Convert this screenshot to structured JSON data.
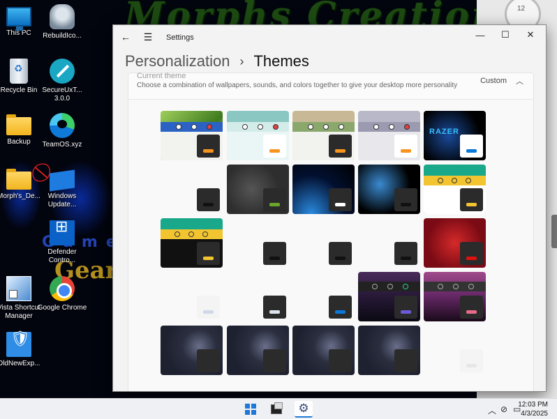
{
  "desktop": {
    "wallpaper_title": "Morphs Creations",
    "wallpaper_text_1": "Gamers",
    "wallpaper_text_2": "Gear",
    "icons": [
      {
        "label": "This PC"
      },
      {
        "label": "RebuildIco..."
      },
      {
        "label": "Recycle Bin"
      },
      {
        "label": "SecureUxT... 3.0.0"
      },
      {
        "label": "Backup"
      },
      {
        "label": "TeamOS.xyz"
      },
      {
        "label": "Morph's_De..."
      },
      {
        "label": "Windows Update..."
      },
      {
        "label": "Defender Contro..."
      },
      {
        "label": "Vista Shortcut Manager"
      },
      {
        "label": "Google Chrome"
      },
      {
        "label": "OldNewExp..."
      }
    ]
  },
  "window": {
    "app_title": "Settings",
    "back_icon": "back-arrow-icon",
    "menu_icon": "hamburger-menu-icon",
    "breadcrumb": {
      "parent": "Personalization",
      "separator": "›",
      "current": "Themes"
    },
    "current_theme": {
      "title": "Current theme",
      "description": "Choose a combination of wallpapers, sounds, and colors together to give your desktop more personality",
      "value": "Custom",
      "chevron": "chevron-up-icon"
    },
    "controls": {
      "minimize": "—",
      "maximize": "☐",
      "close": "✕"
    }
  },
  "taskbar": {
    "time": "12:03 PM",
    "date": "4/3/2025",
    "apps": [
      "start-icon",
      "task-view-icon",
      "settings-icon"
    ],
    "tray_icons": [
      "chevron-up-icon",
      "network-icon",
      "volume-icon"
    ]
  }
}
